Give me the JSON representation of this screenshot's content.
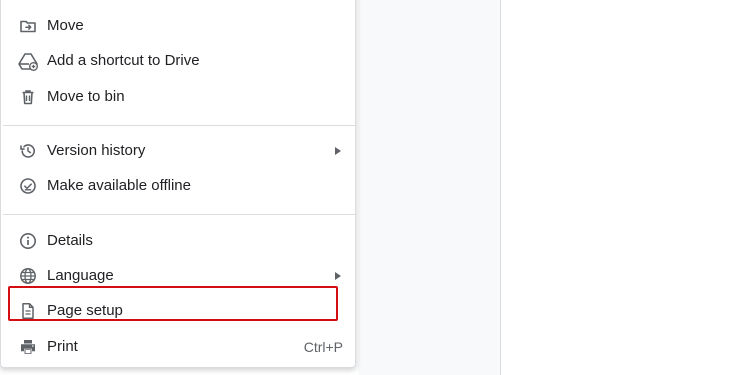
{
  "menu": {
    "items": [
      {
        "label": "Move",
        "icon": "folder-move-icon"
      },
      {
        "label": "Add a shortcut to Drive",
        "icon": "drive-shortcut-icon"
      },
      {
        "label": "Move to bin",
        "icon": "trash-icon"
      },
      {
        "label": "Version history",
        "icon": "history-icon",
        "submenu": true
      },
      {
        "label": "Make available offline",
        "icon": "offline-check-icon"
      },
      {
        "label": "Details",
        "icon": "info-icon"
      },
      {
        "label": "Language",
        "icon": "globe-icon",
        "submenu": true
      },
      {
        "label": "Page setup",
        "icon": "page-icon",
        "highlighted": true
      },
      {
        "label": "Print",
        "icon": "printer-icon",
        "shortcut": "Ctrl+P"
      }
    ]
  },
  "colors": {
    "highlight_border": "#d40d12",
    "text": "#202124",
    "icon": "#5f6368",
    "divider": "#dadce0",
    "side_panel": "#f8f9fa"
  }
}
